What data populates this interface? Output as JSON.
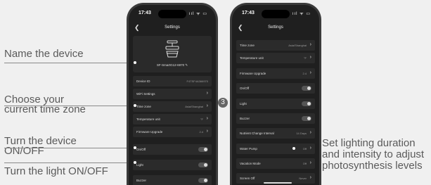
{
  "callouts": {
    "name_device": "Name the device",
    "time_zone_1": "Choose your",
    "time_zone_2": "current time zone",
    "turn_device_1": "Turn the device",
    "turn_device_2": "ON/OFF",
    "turn_light": "Turn the light ON/OFF",
    "lighting_1": "Set lighting duration",
    "lighting_2": "and intensity to adjust",
    "lighting_3": "photosynthesis levels",
    "step_number": "3"
  },
  "phone1": {
    "time": "17:43",
    "status_icons": "ııl ᯤ ▭",
    "title": "Settings",
    "device_name": "SF-SmartG12-6970 ✎",
    "rows": [
      {
        "label": "Device ID",
        "value": "F4TSF4A366970"
      },
      {
        "label": "WiFi Settings",
        "value": ""
      },
      {
        "label": "Time zone",
        "value": "Asia/Shanghai"
      },
      {
        "label": "Temperature unit",
        "value": "°F"
      },
      {
        "label": "Firmware Upgrade",
        "value": "2.4"
      },
      {
        "label": "On/Off",
        "value": ""
      },
      {
        "label": "Light",
        "value": ""
      },
      {
        "label": "Buzzer",
        "value": ""
      }
    ]
  },
  "phone2": {
    "time": "17:43",
    "status_icons": "ııl ᯤ ▭",
    "title": "Settings",
    "rows": [
      {
        "label": "Time zone",
        "value": "Asia/Shanghai"
      },
      {
        "label": "Temperature unit",
        "value": "°F"
      },
      {
        "label": "Firmware Upgrade",
        "value": "2.4"
      },
      {
        "label": "On/Off",
        "value": ""
      },
      {
        "label": "Light",
        "value": ""
      },
      {
        "label": "Buzzer",
        "value": ""
      },
      {
        "label": "Nutrient Change Interval",
        "value": "14 Days"
      },
      {
        "label": "Water Pump",
        "value": "Off"
      },
      {
        "label": "Vacation Mode",
        "value": "Off"
      },
      {
        "label": "Screen Off",
        "value": "Never"
      }
    ]
  }
}
